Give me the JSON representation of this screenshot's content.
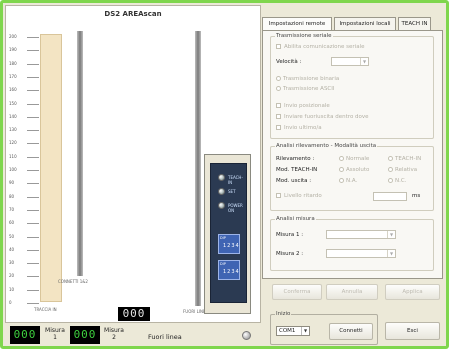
{
  "app": {
    "title": "DS2 AREAscan"
  },
  "ruler": {
    "ticks": [
      "200",
      "190",
      "180",
      "170",
      "160",
      "150",
      "140",
      "130",
      "120",
      "110",
      "100",
      "90",
      "80",
      "70",
      "60",
      "50",
      "40",
      "30",
      "20",
      "10",
      "0"
    ]
  },
  "labels": {
    "left_strip": "TRACCIA IN",
    "bar1": "CONNETTI 1&2",
    "bar2": "FUORI LINEA"
  },
  "device": {
    "led_labels": [
      "TEACH-IN",
      "SET",
      "POWER ON"
    ],
    "dip_labels": [
      "DIP",
      "DIP"
    ],
    "dip_switches": [
      "1234",
      "1234"
    ]
  },
  "displays": {
    "main_seg": "000"
  },
  "status": {
    "lcd1": "000",
    "lcd1_label_1": "Misura",
    "lcd1_label_2": "1",
    "lcd2": "000",
    "lcd2_label_1": "Misura",
    "lcd2_label_2": "2",
    "state": "Fuori linea"
  },
  "tabs": [
    "Impostazioni remote",
    "Impostazioni locali",
    "TEACH IN"
  ],
  "trasmissione": {
    "title": "Trasmissione seriale",
    "abilita": "Abilita comunicazione seriale",
    "velocita_label": "Velocità :",
    "radio1": "Trasmissione binaria",
    "radio2": "Trasmissione ASCII",
    "chk1": "Invio posizionale",
    "chk2": "Inviare fuoriuscita dentro dove",
    "chk3": "Invio ultimo/a"
  },
  "analisi_rilevamento": {
    "title": "Analisi rilevamento - Modalità uscita",
    "rilev_label": "Rilevamento :",
    "rilev_opt1": "Normale",
    "rilev_opt2": "TEACH-IN",
    "teach_label": "Mod. TEACH-IN",
    "teach_opt1": "Assoluto",
    "teach_opt2": "Relativa",
    "uscita_label": "Mod. uscita :",
    "uscita_opt1": "N.A.",
    "uscita_opt2": "N.C.",
    "ritardo": "Livello ritardo",
    "unit": "ms"
  },
  "analisi_misura": {
    "title": "Analisi misura",
    "misura1": "Misura 1 :",
    "misura2": "Misura 2 :"
  },
  "buttons": {
    "conferma": "Conferma",
    "annulla": "Annulla",
    "applica": "Applica"
  },
  "inizio": {
    "title": "Inizio",
    "port": "COM1",
    "connetti": "Connetti"
  },
  "esci": "Esci"
}
